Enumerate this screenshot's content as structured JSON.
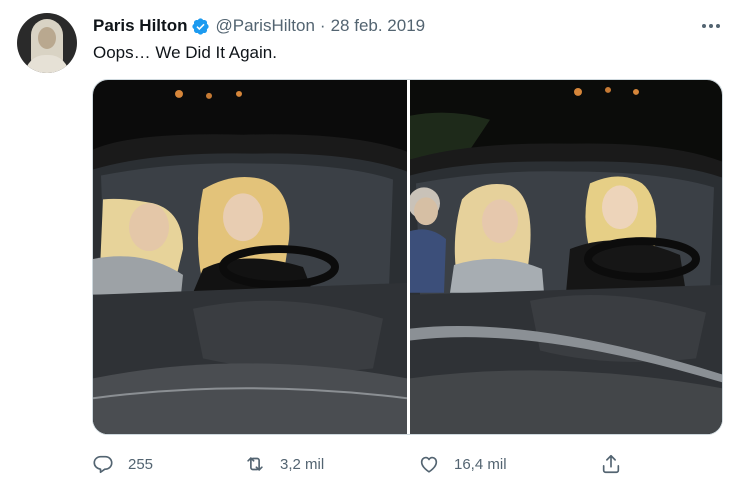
{
  "author": {
    "name": "Paris Hilton",
    "handle": "@ParisHilton",
    "date": "28 feb. 2019",
    "verified": true
  },
  "tweet": {
    "text": "Oops… We Did It Again."
  },
  "media": {
    "photo_count": 2,
    "photos": [
      {
        "description_icon": "photo-car-night-1"
      },
      {
        "description_icon": "photo-car-night-2"
      }
    ]
  },
  "actions": {
    "reply_count": "255",
    "retweet_count": "3,2 mil",
    "like_count": "16,4 mil"
  },
  "colors": {
    "verified_badge": "#1d9bf0",
    "muted_text": "#536471",
    "text": "#0f1419"
  }
}
